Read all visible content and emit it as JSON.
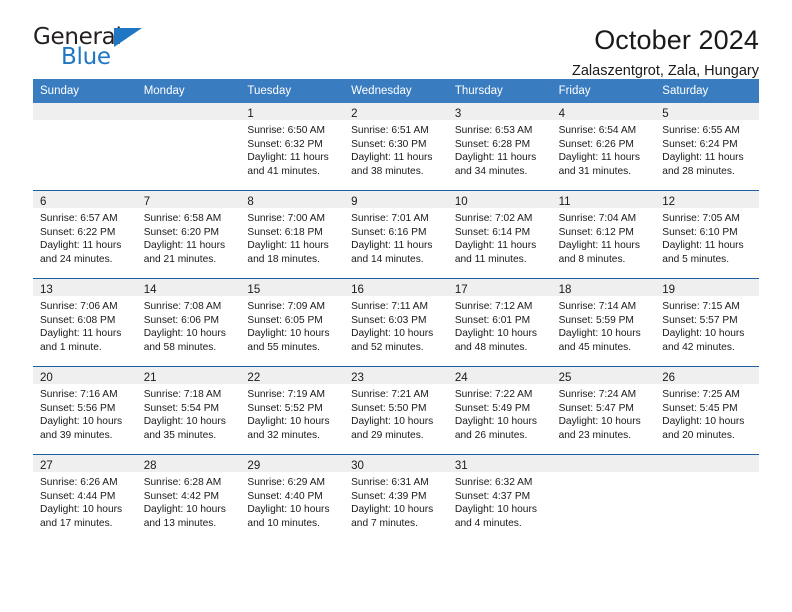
{
  "brand": {
    "name_top": "General",
    "name_bottom": "Blue",
    "triangle_color": "#1f76c2",
    "text_color": "#231f20"
  },
  "header": {
    "title": "October 2024",
    "subtitle": "Zalaszentgrot, Zala, Hungary"
  },
  "colors": {
    "header_band": "#3a7cc0",
    "week_divider": "#1f5fa0",
    "day_strip": "#efefef",
    "text": "#1a1a1a",
    "weekday_text": "#ffffff"
  },
  "weekdays": [
    "Sunday",
    "Monday",
    "Tuesday",
    "Wednesday",
    "Thursday",
    "Friday",
    "Saturday"
  ],
  "labels": {
    "sunrise_prefix": "Sunrise:",
    "sunset_prefix": "Sunset:",
    "daylight_prefix": "Daylight:"
  },
  "weeks": [
    [
      {
        "day": "",
        "sunrise": "",
        "sunset": "",
        "daylight": ""
      },
      {
        "day": "",
        "sunrise": "",
        "sunset": "",
        "daylight": ""
      },
      {
        "day": "1",
        "sunrise": "Sunrise: 6:50 AM",
        "sunset": "Sunset: 6:32 PM",
        "daylight": "Daylight: 11 hours and 41 minutes."
      },
      {
        "day": "2",
        "sunrise": "Sunrise: 6:51 AM",
        "sunset": "Sunset: 6:30 PM",
        "daylight": "Daylight: 11 hours and 38 minutes."
      },
      {
        "day": "3",
        "sunrise": "Sunrise: 6:53 AM",
        "sunset": "Sunset: 6:28 PM",
        "daylight": "Daylight: 11 hours and 34 minutes."
      },
      {
        "day": "4",
        "sunrise": "Sunrise: 6:54 AM",
        "sunset": "Sunset: 6:26 PM",
        "daylight": "Daylight: 11 hours and 31 minutes."
      },
      {
        "day": "5",
        "sunrise": "Sunrise: 6:55 AM",
        "sunset": "Sunset: 6:24 PM",
        "daylight": "Daylight: 11 hours and 28 minutes."
      }
    ],
    [
      {
        "day": "6",
        "sunrise": "Sunrise: 6:57 AM",
        "sunset": "Sunset: 6:22 PM",
        "daylight": "Daylight: 11 hours and 24 minutes."
      },
      {
        "day": "7",
        "sunrise": "Sunrise: 6:58 AM",
        "sunset": "Sunset: 6:20 PM",
        "daylight": "Daylight: 11 hours and 21 minutes."
      },
      {
        "day": "8",
        "sunrise": "Sunrise: 7:00 AM",
        "sunset": "Sunset: 6:18 PM",
        "daylight": "Daylight: 11 hours and 18 minutes."
      },
      {
        "day": "9",
        "sunrise": "Sunrise: 7:01 AM",
        "sunset": "Sunset: 6:16 PM",
        "daylight": "Daylight: 11 hours and 14 minutes."
      },
      {
        "day": "10",
        "sunrise": "Sunrise: 7:02 AM",
        "sunset": "Sunset: 6:14 PM",
        "daylight": "Daylight: 11 hours and 11 minutes."
      },
      {
        "day": "11",
        "sunrise": "Sunrise: 7:04 AM",
        "sunset": "Sunset: 6:12 PM",
        "daylight": "Daylight: 11 hours and 8 minutes."
      },
      {
        "day": "12",
        "sunrise": "Sunrise: 7:05 AM",
        "sunset": "Sunset: 6:10 PM",
        "daylight": "Daylight: 11 hours and 5 minutes."
      }
    ],
    [
      {
        "day": "13",
        "sunrise": "Sunrise: 7:06 AM",
        "sunset": "Sunset: 6:08 PM",
        "daylight": "Daylight: 11 hours and 1 minute."
      },
      {
        "day": "14",
        "sunrise": "Sunrise: 7:08 AM",
        "sunset": "Sunset: 6:06 PM",
        "daylight": "Daylight: 10 hours and 58 minutes."
      },
      {
        "day": "15",
        "sunrise": "Sunrise: 7:09 AM",
        "sunset": "Sunset: 6:05 PM",
        "daylight": "Daylight: 10 hours and 55 minutes."
      },
      {
        "day": "16",
        "sunrise": "Sunrise: 7:11 AM",
        "sunset": "Sunset: 6:03 PM",
        "daylight": "Daylight: 10 hours and 52 minutes."
      },
      {
        "day": "17",
        "sunrise": "Sunrise: 7:12 AM",
        "sunset": "Sunset: 6:01 PM",
        "daylight": "Daylight: 10 hours and 48 minutes."
      },
      {
        "day": "18",
        "sunrise": "Sunrise: 7:14 AM",
        "sunset": "Sunset: 5:59 PM",
        "daylight": "Daylight: 10 hours and 45 minutes."
      },
      {
        "day": "19",
        "sunrise": "Sunrise: 7:15 AM",
        "sunset": "Sunset: 5:57 PM",
        "daylight": "Daylight: 10 hours and 42 minutes."
      }
    ],
    [
      {
        "day": "20",
        "sunrise": "Sunrise: 7:16 AM",
        "sunset": "Sunset: 5:56 PM",
        "daylight": "Daylight: 10 hours and 39 minutes."
      },
      {
        "day": "21",
        "sunrise": "Sunrise: 7:18 AM",
        "sunset": "Sunset: 5:54 PM",
        "daylight": "Daylight: 10 hours and 35 minutes."
      },
      {
        "day": "22",
        "sunrise": "Sunrise: 7:19 AM",
        "sunset": "Sunset: 5:52 PM",
        "daylight": "Daylight: 10 hours and 32 minutes."
      },
      {
        "day": "23",
        "sunrise": "Sunrise: 7:21 AM",
        "sunset": "Sunset: 5:50 PM",
        "daylight": "Daylight: 10 hours and 29 minutes."
      },
      {
        "day": "24",
        "sunrise": "Sunrise: 7:22 AM",
        "sunset": "Sunset: 5:49 PM",
        "daylight": "Daylight: 10 hours and 26 minutes."
      },
      {
        "day": "25",
        "sunrise": "Sunrise: 7:24 AM",
        "sunset": "Sunset: 5:47 PM",
        "daylight": "Daylight: 10 hours and 23 minutes."
      },
      {
        "day": "26",
        "sunrise": "Sunrise: 7:25 AM",
        "sunset": "Sunset: 5:45 PM",
        "daylight": "Daylight: 10 hours and 20 minutes."
      }
    ],
    [
      {
        "day": "27",
        "sunrise": "Sunrise: 6:26 AM",
        "sunset": "Sunset: 4:44 PM",
        "daylight": "Daylight: 10 hours and 17 minutes."
      },
      {
        "day": "28",
        "sunrise": "Sunrise: 6:28 AM",
        "sunset": "Sunset: 4:42 PM",
        "daylight": "Daylight: 10 hours and 13 minutes."
      },
      {
        "day": "29",
        "sunrise": "Sunrise: 6:29 AM",
        "sunset": "Sunset: 4:40 PM",
        "daylight": "Daylight: 10 hours and 10 minutes."
      },
      {
        "day": "30",
        "sunrise": "Sunrise: 6:31 AM",
        "sunset": "Sunset: 4:39 PM",
        "daylight": "Daylight: 10 hours and 7 minutes."
      },
      {
        "day": "31",
        "sunrise": "Sunrise: 6:32 AM",
        "sunset": "Sunset: 4:37 PM",
        "daylight": "Daylight: 10 hours and 4 minutes."
      },
      {
        "day": "",
        "sunrise": "",
        "sunset": "",
        "daylight": ""
      },
      {
        "day": "",
        "sunrise": "",
        "sunset": "",
        "daylight": ""
      }
    ]
  ]
}
